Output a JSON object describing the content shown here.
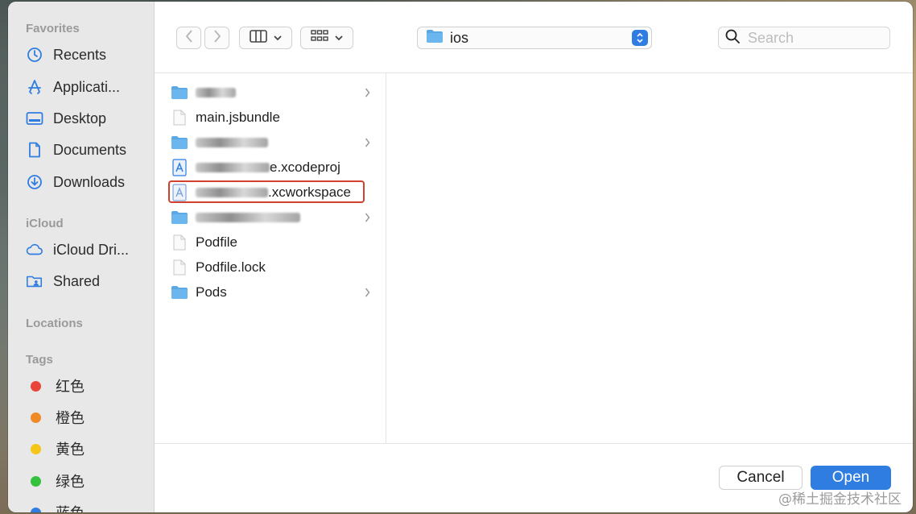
{
  "sidebar": {
    "favorites_title": "Favorites",
    "favorites": [
      {
        "label": "Recents",
        "icon": "clock-icon"
      },
      {
        "label": "Applicati...",
        "icon": "applications-icon"
      },
      {
        "label": "Desktop",
        "icon": "desktop-icon"
      },
      {
        "label": "Documents",
        "icon": "document-icon"
      },
      {
        "label": "Downloads",
        "icon": "download-icon"
      }
    ],
    "icloud_title": "iCloud",
    "icloud": [
      {
        "label": "iCloud Dri...",
        "icon": "cloud-icon"
      },
      {
        "label": "Shared",
        "icon": "shared-folder-icon"
      }
    ],
    "locations_title": "Locations",
    "tags_title": "Tags",
    "tags": [
      {
        "label": "红色",
        "color": "#e8443a"
      },
      {
        "label": "橙色",
        "color": "#f08a24"
      },
      {
        "label": "黄色",
        "color": "#f5c518"
      },
      {
        "label": "绿色",
        "color": "#34c23d"
      },
      {
        "label": "蓝色",
        "color": "#2f7de1"
      }
    ]
  },
  "toolbar": {
    "location": "ios",
    "search_placeholder": "Search"
  },
  "files": [
    {
      "name": "",
      "kind": "folder",
      "blurred": true,
      "chevron": true
    },
    {
      "name": "main.jsbundle",
      "kind": "file"
    },
    {
      "name": "",
      "kind": "folder",
      "blurred": true,
      "chevron": true
    },
    {
      "name": "e.xcodeproj",
      "kind": "xcodeproj",
      "blurred_prefix": true
    },
    {
      "name": ".xcworkspace",
      "kind": "xcworkspace",
      "blurred_prefix": true,
      "highlighted": true
    },
    {
      "name": "",
      "kind": "folder",
      "blurred": true,
      "chevron": true
    },
    {
      "name": "Podfile",
      "kind": "file"
    },
    {
      "name": "Podfile.lock",
      "kind": "file"
    },
    {
      "name": "Pods",
      "kind": "folder",
      "chevron": true
    }
  ],
  "footer": {
    "cancel_label": "Cancel",
    "open_label": "Open"
  },
  "watermark": "@稀土掘金技术社区",
  "colors": {
    "accent": "#2f7de1",
    "highlight_border": "#d2402e",
    "folder": "#5aa9e6"
  }
}
